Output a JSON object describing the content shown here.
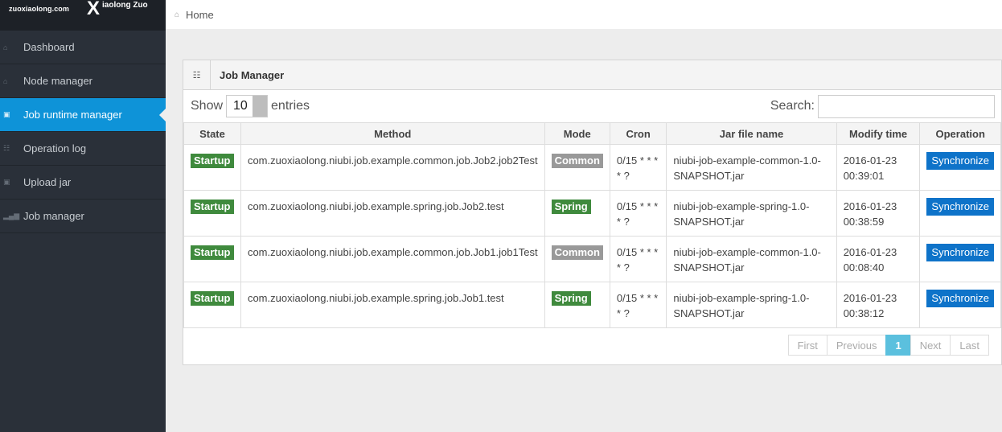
{
  "brand": {
    "site": "zuoxiaolong.com",
    "logo_x": "X",
    "logo_name": "iaolong Zuo"
  },
  "sidebar": {
    "items": [
      {
        "label": "Dashboard",
        "icon": "home-icon",
        "glyph": "⌂"
      },
      {
        "label": "Node manager",
        "icon": "home-icon",
        "glyph": "⌂"
      },
      {
        "label": "Job runtime manager",
        "icon": "inbox-icon",
        "glyph": "▣",
        "active": true
      },
      {
        "label": "Operation log",
        "icon": "grid-icon",
        "glyph": "☷"
      },
      {
        "label": "Upload jar",
        "icon": "inbox-icon",
        "glyph": "▣"
      },
      {
        "label": "Job manager",
        "icon": "signal-icon",
        "glyph": "▂▄▆"
      }
    ]
  },
  "breadcrumb": {
    "home": "Home"
  },
  "panel": {
    "title": "Job Manager"
  },
  "controls": {
    "show": "Show",
    "length": "10",
    "entries": "entries",
    "search": "Search:",
    "search_value": ""
  },
  "table": {
    "headers": [
      "State",
      "Method",
      "Mode",
      "Cron",
      "Jar file name",
      "Modify time",
      "Operation"
    ],
    "rows": [
      {
        "state": "Startup",
        "method": "com.zuoxiaolong.niubi.job.example.common.job.Job2.job2Test",
        "mode": "Common",
        "mode_type": "default",
        "cron": "0/15 * * * * ?",
        "jar": "niubi-job-example-common-1.0-SNAPSHOT.jar",
        "time": "2016-01-23 00:39:01",
        "op": "Synchronize"
      },
      {
        "state": "Startup",
        "method": "com.zuoxiaolong.niubi.job.example.spring.job.Job2.test",
        "mode": "Spring",
        "mode_type": "success",
        "cron": "0/15 * * * * ?",
        "jar": "niubi-job-example-spring-1.0-SNAPSHOT.jar",
        "time": "2016-01-23 00:38:59",
        "op": "Synchronize"
      },
      {
        "state": "Startup",
        "method": "com.zuoxiaolong.niubi.job.example.common.job.Job1.job1Test",
        "mode": "Common",
        "mode_type": "default",
        "cron": "0/15 * * * * ?",
        "jar": "niubi-job-example-common-1.0-SNAPSHOT.jar",
        "time": "2016-01-23 00:08:40",
        "op": "Synchronize"
      },
      {
        "state": "Startup",
        "method": "com.zuoxiaolong.niubi.job.example.spring.job.Job1.test",
        "mode": "Spring",
        "mode_type": "success",
        "cron": "0/15 * * * * ?",
        "jar": "niubi-job-example-spring-1.0-SNAPSHOT.jar",
        "time": "2016-01-23 00:38:12",
        "op": "Synchronize"
      }
    ]
  },
  "pager": {
    "first": "First",
    "previous": "Previous",
    "current": "1",
    "next": "Next",
    "last": "Last"
  },
  "colors": {
    "sidebar_bg": "#2a3039",
    "active": "#0e93d8",
    "success": "#3f8a3d",
    "default": "#999999",
    "button": "#0e73c9",
    "page_active": "#5bc0de"
  }
}
